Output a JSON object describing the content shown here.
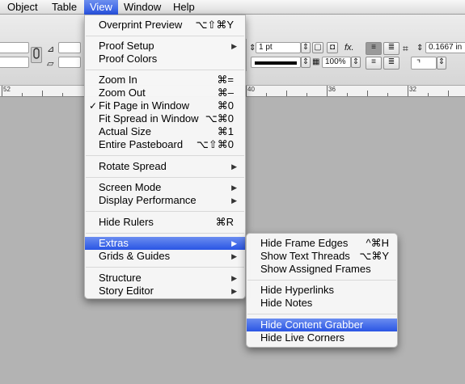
{
  "menubar": {
    "items": [
      {
        "label": "Object"
      },
      {
        "label": "Table"
      },
      {
        "label": "View"
      },
      {
        "label": "Window"
      },
      {
        "label": "Help"
      }
    ]
  },
  "control": {
    "stroke_weight": "1 pt",
    "scale_percent": "100%",
    "offset_value": "0.1667 in"
  },
  "ruler": {
    "labels": [
      "52",
      "40",
      "36",
      "32"
    ]
  },
  "view_menu": {
    "items": [
      {
        "label": "Overprint Preview",
        "shortcut": "⌥⇧⌘Y"
      },
      {
        "label": "Proof Setup",
        "submenu": true
      },
      {
        "label": "Proof Colors"
      },
      {
        "label": "Zoom In",
        "shortcut": "⌘="
      },
      {
        "label": "Zoom Out",
        "shortcut": "⌘–"
      },
      {
        "label": "Fit Page in Window",
        "shortcut": "⌘0",
        "checked": true
      },
      {
        "label": "Fit Spread in Window",
        "shortcut": "⌥⌘0"
      },
      {
        "label": "Actual Size",
        "shortcut": "⌘1"
      },
      {
        "label": "Entire Pasteboard",
        "shortcut": "⌥⇧⌘0"
      },
      {
        "label": "Rotate Spread",
        "submenu": true
      },
      {
        "label": "Screen Mode",
        "submenu": true
      },
      {
        "label": "Display Performance",
        "submenu": true
      },
      {
        "label": "Hide Rulers",
        "shortcut": "⌘R"
      },
      {
        "label": "Extras",
        "submenu": true,
        "highlighted": true
      },
      {
        "label": "Grids & Guides",
        "submenu": true
      },
      {
        "label": "Structure",
        "submenu": true
      },
      {
        "label": "Story Editor",
        "submenu": true
      }
    ]
  },
  "extras_menu": {
    "items": [
      {
        "label": "Hide Frame Edges",
        "shortcut": "^⌘H"
      },
      {
        "label": "Show Text Threads",
        "shortcut": "⌥⌘Y"
      },
      {
        "label": "Show Assigned Frames"
      },
      {
        "label": "Hide Hyperlinks"
      },
      {
        "label": "Hide Notes"
      },
      {
        "label": "Hide Content Grabber",
        "highlighted": true
      },
      {
        "label": "Hide Live Corners"
      }
    ]
  },
  "colors": {
    "menu_highlight": "#2a55e4",
    "checkmark_symbol": "✓",
    "submenu_arrow": "▶"
  }
}
